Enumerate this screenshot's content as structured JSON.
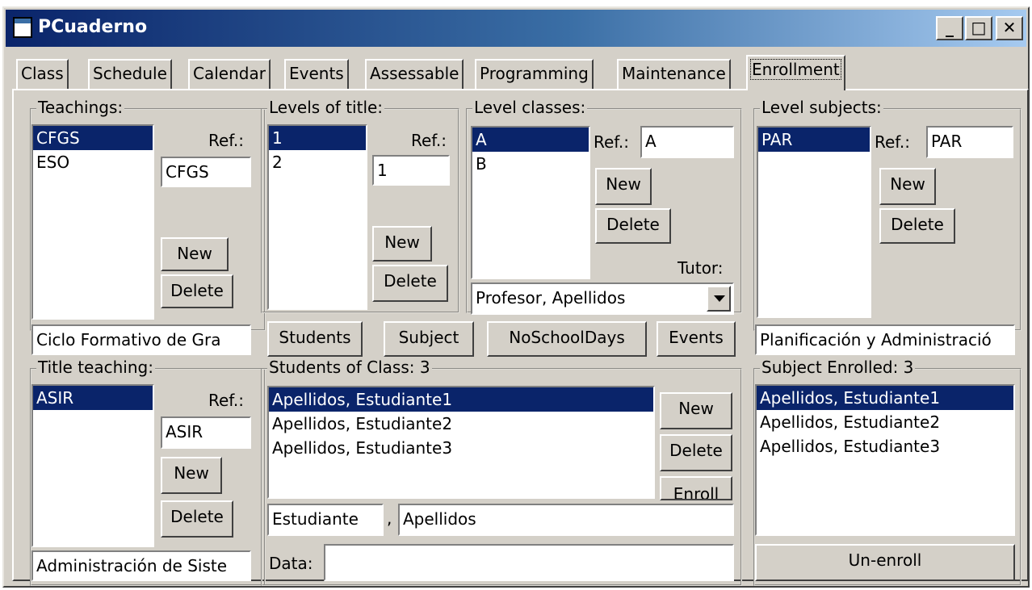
{
  "window": {
    "title": "PCuaderno",
    "minimize": "_",
    "maximize": "□",
    "close": "✕"
  },
  "tabs": [
    "Class",
    "Schedule",
    "Calendar",
    "Events",
    "Assessable",
    "Programming",
    "Maintenance",
    "Enrollment"
  ],
  "active_tab": "Enrollment",
  "teachings": {
    "legend": "Teachings:",
    "items": [
      "CFGS",
      "ESO"
    ],
    "selected": "CFGS",
    "ref_label": "Ref.:",
    "ref_value": "CFGS",
    "new_label": "New",
    "delete_label": "Delete",
    "description": "Ciclo Formativo de Gra"
  },
  "levels_of_title": {
    "legend": "Levels of title:",
    "items": [
      "1",
      "2"
    ],
    "selected": "1",
    "ref_label": "Ref.:",
    "ref_value": "1",
    "new_label": "New",
    "delete_label": "Delete"
  },
  "level_classes": {
    "legend": "Level classes:",
    "items": [
      "A",
      "B"
    ],
    "selected": "A",
    "ref_label": "Ref.:",
    "ref_value": "A",
    "new_label": "New",
    "delete_label": "Delete",
    "tutor_label": "Tutor:",
    "tutor_value": "Profesor, Apellidos"
  },
  "level_subjects": {
    "legend": "Level subjects:",
    "items": [
      "PAR"
    ],
    "selected": "PAR",
    "ref_label": "Ref.:",
    "ref_value": "PAR",
    "new_label": "New",
    "delete_label": "Delete",
    "description": "Planificación y Administració"
  },
  "action_buttons": {
    "students": "Students",
    "subject": "Subject",
    "noschooldays": "NoSchoolDays",
    "events": "Events"
  },
  "title_teaching": {
    "legend": "Title teaching:",
    "items": [
      "ASIR"
    ],
    "selected": "ASIR",
    "ref_label": "Ref.:",
    "ref_value": "ASIR",
    "new_label": "New",
    "delete_label": "Delete",
    "description": "Administración de Siste"
  },
  "students_of_class": {
    "legend": "Students of Class: 3",
    "items": [
      "Apellidos, Estudiante1",
      "Apellidos, Estudiante2",
      "Apellidos, Estudiante3"
    ],
    "selected": "Apellidos, Estudiante1",
    "new_label": "New",
    "delete_label": "Delete",
    "enroll_label": "Enroll",
    "first_name": "Estudiante",
    "separator": ",",
    "last_name": "Apellidos",
    "data_label": "Data:",
    "data_value": ""
  },
  "subject_enrolled": {
    "legend": "Subject Enrolled: 3",
    "items": [
      "Apellidos, Estudiante1",
      "Apellidos, Estudiante2",
      "Apellidos, Estudiante3"
    ],
    "selected": "Apellidos, Estudiante1",
    "unenroll_label": "Un-enroll"
  },
  "colors": {
    "face": "#d4d0c8",
    "selection": "#0a246a",
    "title_start": "#0a246a",
    "title_end": "#a6caf0"
  }
}
